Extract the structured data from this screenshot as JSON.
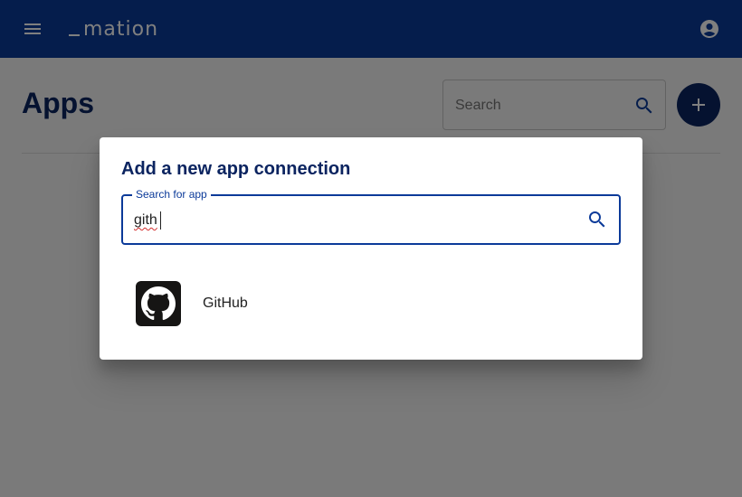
{
  "appbar": {
    "logo_text": "mation",
    "menu_icon": "menu-icon",
    "account_icon": "account-circle-icon",
    "background": "#0b3a99"
  },
  "page": {
    "title": "Apps",
    "search": {
      "placeholder": "Search",
      "icon": "search-icon"
    },
    "add_button_icon": "plus-icon"
  },
  "dialog": {
    "title": "Add a new app connection",
    "search_field": {
      "label": "Search for app",
      "value": "gith",
      "icon": "search-icon"
    },
    "results": [
      {
        "name": "GitHub",
        "icon": "github-icon"
      }
    ]
  },
  "colors": {
    "primary": "#0b3a99",
    "dark": "#0b2460"
  }
}
